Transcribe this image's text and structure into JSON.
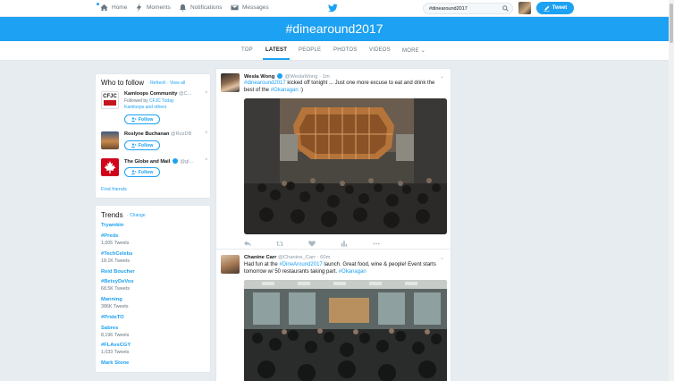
{
  "nav": {
    "home": "Home",
    "moments": "Moments",
    "notifications": "Notifications",
    "messages": "Messages",
    "tweet_button": "Tweet"
  },
  "search": {
    "value": "#dinearound2017"
  },
  "banner": {
    "hashtag": "#dinearound2017"
  },
  "tabs": [
    {
      "label": "TOP"
    },
    {
      "label": "LATEST",
      "active": true
    },
    {
      "label": "PEOPLE"
    },
    {
      "label": "PHOTOS"
    },
    {
      "label": "VIDEOS"
    },
    {
      "label": "MORE"
    }
  ],
  "who_to_follow": {
    "title": "Who to follow",
    "refresh": "Refresh",
    "view_all": "View all",
    "separator": "·",
    "recommendations": [
      {
        "name": "Kamloops Community",
        "handle": "@C...",
        "followed_by": "Followed by ",
        "followed_link": "CFJC Today",
        "followed_extra": "Kamloops and others",
        "avatar_text": "CFJC",
        "button": "Follow"
      },
      {
        "name": "Roslyne Buchanan",
        "handle": "@RozDB",
        "button": "Follow"
      },
      {
        "name": "The Globe and Mail",
        "handle": "@gl...",
        "button": "Follow"
      }
    ],
    "find_friends": "Find friends"
  },
  "trends": {
    "title": "Trends",
    "change": "Change",
    "items": [
      {
        "name": "Tryamkin",
        "count": ""
      },
      {
        "name": "#Preds",
        "count": "1,005 Tweets"
      },
      {
        "name": "#TechCelebs",
        "count": "18.1K Tweets"
      },
      {
        "name": "Reid Boucher",
        "count": ""
      },
      {
        "name": "#BetsyDeVos",
        "count": "68.5K Tweets"
      },
      {
        "name": "Manning",
        "count": "386K Tweets"
      },
      {
        "name": "#PrideTO",
        "count": ""
      },
      {
        "name": "Sabres",
        "count": "8,196 Tweets"
      },
      {
        "name": "#FLAvsCGY",
        "count": "1,033 Tweets"
      },
      {
        "name": "Mark Stone",
        "count": ""
      }
    ]
  },
  "tweets": [
    {
      "name": "Wesla Wong",
      "handle": "@WeslaWong",
      "time": "· 1m",
      "tag1": "#dinearound2017",
      "text1": " kicked off tonight ... Just one more excuse to eat and drink the best of the ",
      "tag2": "#Okanagan",
      "text2": " :)"
    },
    {
      "name": "Chanine Carr",
      "handle": "@Chanine_Carr",
      "time": "· 60m",
      "text1": "Had fun at the ",
      "tag1": "#DineAround2017",
      "text2": " launch. Great food, wine & people! Event starts tomorrow w/ 50 restaurants taking part. ",
      "tag2": "#Okanagan"
    }
  ],
  "colors": {
    "accent": "#1da1f2",
    "background": "#e6ecf0",
    "muted": "#66757f"
  }
}
